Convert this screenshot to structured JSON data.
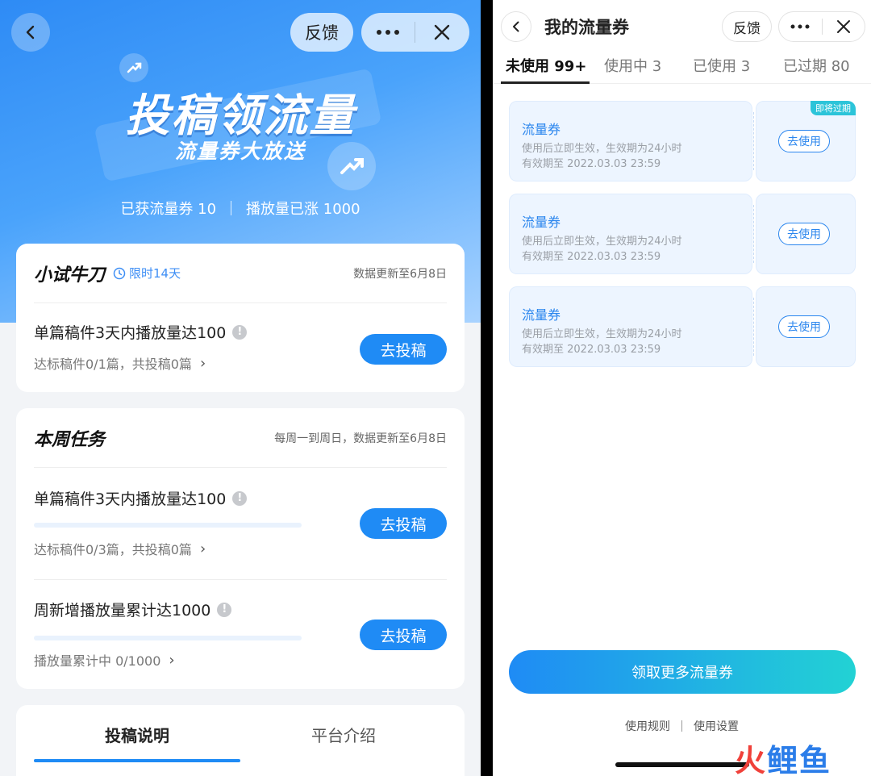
{
  "left": {
    "header": {
      "feedback_label": "反馈"
    },
    "hero": {
      "title": "投稿领流量",
      "subtitle": "流量券大放送",
      "stat_coupons": "已获流量券 10",
      "stat_plays": "播放量已涨 1000"
    },
    "trial_card": {
      "title": "小试牛刀",
      "badge": "限时14天",
      "meta": "数据更新至6月8日",
      "task": {
        "title": "单篇稿件3天内播放量达100",
        "sub": "达标稿件0/1篇，共投稿0篇",
        "button": "去投稿"
      }
    },
    "weekly_card": {
      "title": "本周任务",
      "meta": "每周一到周日，数据更新至6月8日",
      "tasks": [
        {
          "title": "单篇稿件3天内播放量达100",
          "sub": "达标稿件0/3篇，共投稿0篇",
          "button": "去投稿"
        },
        {
          "title": "周新增播放量累计达1000",
          "sub": "播放量累计中 0/1000",
          "button": "去投稿"
        }
      ]
    },
    "bottom_tabs": {
      "active": "投稿说明",
      "inactive": "平台介绍"
    }
  },
  "right": {
    "header": {
      "title": "我的流量券",
      "feedback_label": "反馈"
    },
    "tabs": [
      "未使用 99+",
      "使用中 3",
      "已使用 3",
      "已过期 80"
    ],
    "active_tab": "未使用 99+",
    "coupons": [
      {
        "name": "流量券",
        "desc": "使用后立即生效，生效期为24小时",
        "expiry": "有效期至 2022.03.03 23:59",
        "button": "去使用",
        "tag": "即将过期"
      },
      {
        "name": "流量券",
        "desc": "使用后立即生效，生效期为24小时",
        "expiry": "有效期至 2022.03.03 23:59",
        "button": "去使用"
      },
      {
        "name": "流量券",
        "desc": "使用后立即生效，生效期为24小时",
        "expiry": "有效期至 2022.03.03 23:59",
        "button": "去使用"
      }
    ],
    "cta": "领取更多流量券",
    "footer": {
      "rules": "使用规则",
      "settings": "使用设置"
    },
    "watermark": {
      "c1": "火",
      "c2": "鲤",
      "c3": "鱼"
    }
  },
  "colors": {
    "primary": "#1f8bf5",
    "accent_teal": "#22d2d4",
    "watermark_red": "#f0413a",
    "watermark_blue": "#2b7de9"
  },
  "icons": [
    "back-arrow-icon",
    "more-dots-icon",
    "close-x-icon",
    "clock-icon",
    "info-icon",
    "chevron-right-icon",
    "trend-arrow-icon"
  ]
}
